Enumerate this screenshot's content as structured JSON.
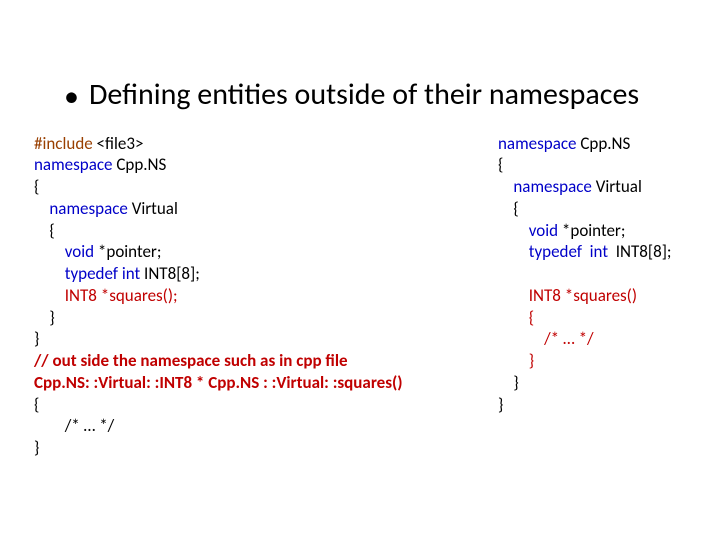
{
  "title": "Defining entities outside of their namespaces",
  "left": {
    "l1a": "#include",
    "l1b": " <file3>",
    "l2a": "namespace",
    "l2b": " Cpp.NS",
    "l3": "{",
    "l4a": "    namespace",
    "l4b": " Virtual",
    "l5": "    {",
    "l6a": "        void",
    "l6b": " *pointer;",
    "l7a": "        typedef ",
    "l7b": "int",
    "l7c": " INT8[8];",
    "l8": "        INT8 *squares();",
    "l9": "    }",
    "l10": "}",
    "l11": "// out side the namespace such as in cpp file",
    "l12": "Cpp.NS: :Virtual: :INT8 * Cpp.NS : :Virtual: :squares()",
    "l13": "{",
    "l14": "        /* … */",
    "l15": "}"
  },
  "right": {
    "l1a": "namespace",
    "l1b": " Cpp.NS",
    "l2": "{",
    "l3a": "    namespace",
    "l3b": " Virtual",
    "l4": "    {",
    "l5a": "        void",
    "l5b": " *pointer;",
    "l6a": "        typedef  ",
    "l6b": "int",
    "l6c": "  INT8[8];",
    "l7": " ",
    "l8": "        INT8 *squares()",
    "l9": "        {",
    "l10": "            /* … */",
    "l11": "        }",
    "l12": "    }",
    "l13": "}"
  }
}
